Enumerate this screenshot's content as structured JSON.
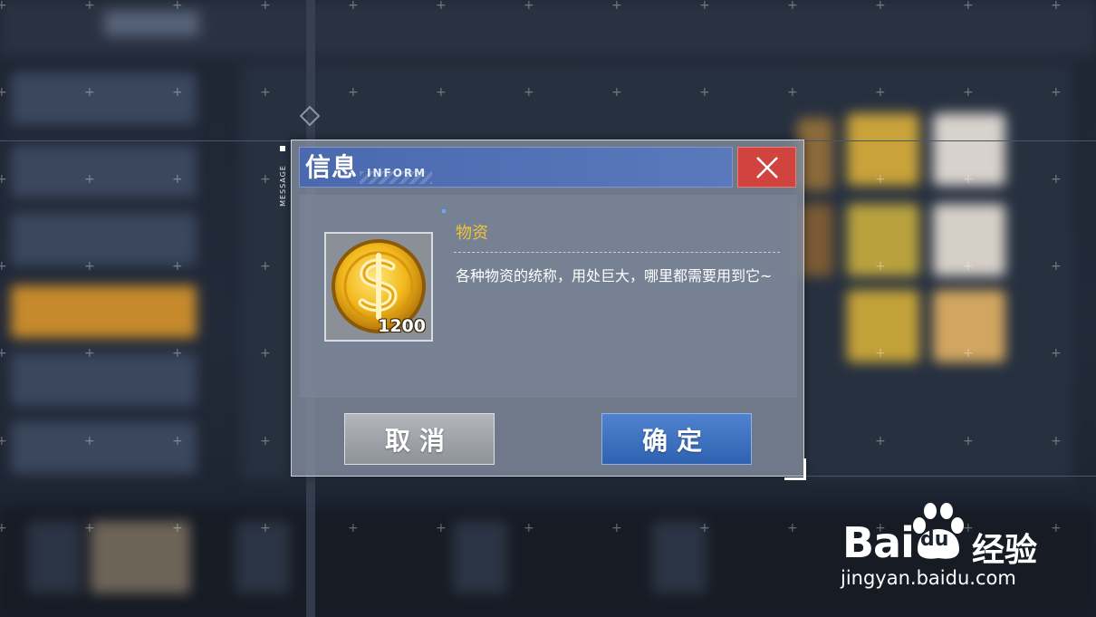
{
  "dialog": {
    "title_cn": "信息",
    "title_en": "INFORM",
    "side_label": "MESSAGE",
    "close_icon": "close-x-icon",
    "cancel_label": "取消",
    "confirm_label": "确定"
  },
  "item": {
    "icon": "gold-coin-icon",
    "quantity": "1200",
    "name": "物资",
    "description": "各种物资的统称，用处巨大，哪里都需要用到它~"
  },
  "watermark": {
    "brand_prefix": "Bai",
    "brand_paw_text": "du",
    "brand_suffix": "经验",
    "url": "jingyan.baidu.com"
  },
  "colors": {
    "title_bar": "#4a69ae",
    "close_button": "#d0433f",
    "confirm_button": "#3a6fc0",
    "cancel_button": "#a3a7ad",
    "item_name": "#f0c43a"
  }
}
